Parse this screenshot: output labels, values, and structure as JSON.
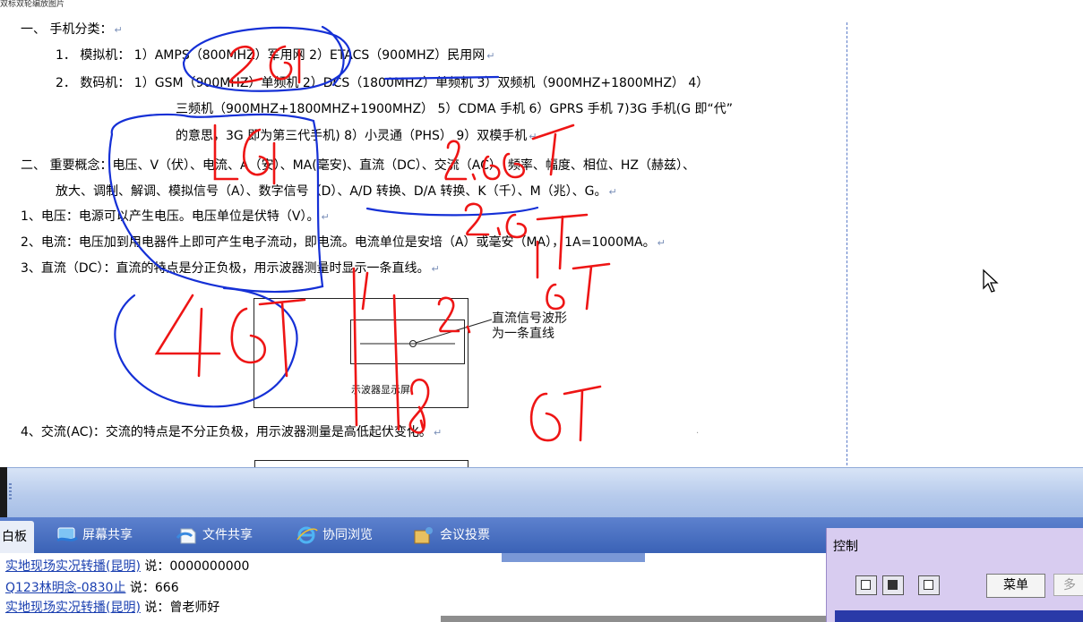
{
  "doc": {
    "caption": "双标双轮编放图片",
    "lines": [
      "一、 手机分类：",
      "1．  模拟机： 1）AMPS（800MHZ）军用网    2）ETACS（900MHZ）民用网",
      "2．  数码机： 1）GSM（900MHZ）单频机    2）DCS（1800MHZ）单频机    3）双频机（900MHZ+1800MHZ）   4）",
      "三频机（900MHZ+1800MHZ+1900MHZ）  5）CDMA 手机   6）GPRS 手机  7)3G 手机(G 即“代”",
      "的意思，3G 即为第三代手机)   8）小灵通（PHS）  9）双模手机",
      "二、 重要概念：电压、V（伏）、电流、A（安）、MA(毫安)、直流（DC）、交流（AC）、频率、幅度、相位、HZ（赫兹）、",
      "放大、调制、解调、模拟信号（A）、数字信号（D）、A/D 转换、D/A 转换、K（千）、M（兆）、G。",
      "1、电压：电源可以产生电压。电压单位是伏特（V）。",
      "2、电流：电压加到用电器件上即可产生电子流动，即电流。电流单位是安培（A）或毫安（MA），1A=1000MA。",
      "3、直流（DC）：直流的特点是分正负极，用示波器测量时显示一条直线。",
      "4、交流(AC)：交流的特点是不分正负极，用示波器测量是高低起伏变化。"
    ],
    "return_mark": "↵",
    "scope_label": "示波器显示屏",
    "annotation": [
      "直流信号波形",
      "为一条直线"
    ]
  },
  "ink_notes": {
    "n1": "2G",
    "n2": "2.5G",
    "n3": "2.75G",
    "n4": "3G",
    "n5": "3.5G",
    "n6": "4G"
  },
  "tabs": {
    "whiteboard": "白板",
    "screen_share": "屏幕共享",
    "file_share": "文件共享",
    "co_browse": "协同浏览",
    "vote": "会议投票"
  },
  "chat": {
    "said": "说：",
    "messages": [
      {
        "user": "实地现场实况转播(昆明)",
        "text": "0000000000"
      },
      {
        "user": "Q123林明念-0830止",
        "text": "666"
      },
      {
        "user": "实地现场实况转播(昆明)",
        "text": "曾老师好"
      }
    ]
  },
  "control": {
    "title": "控制",
    "menu": "菜单",
    "more": "多"
  }
}
